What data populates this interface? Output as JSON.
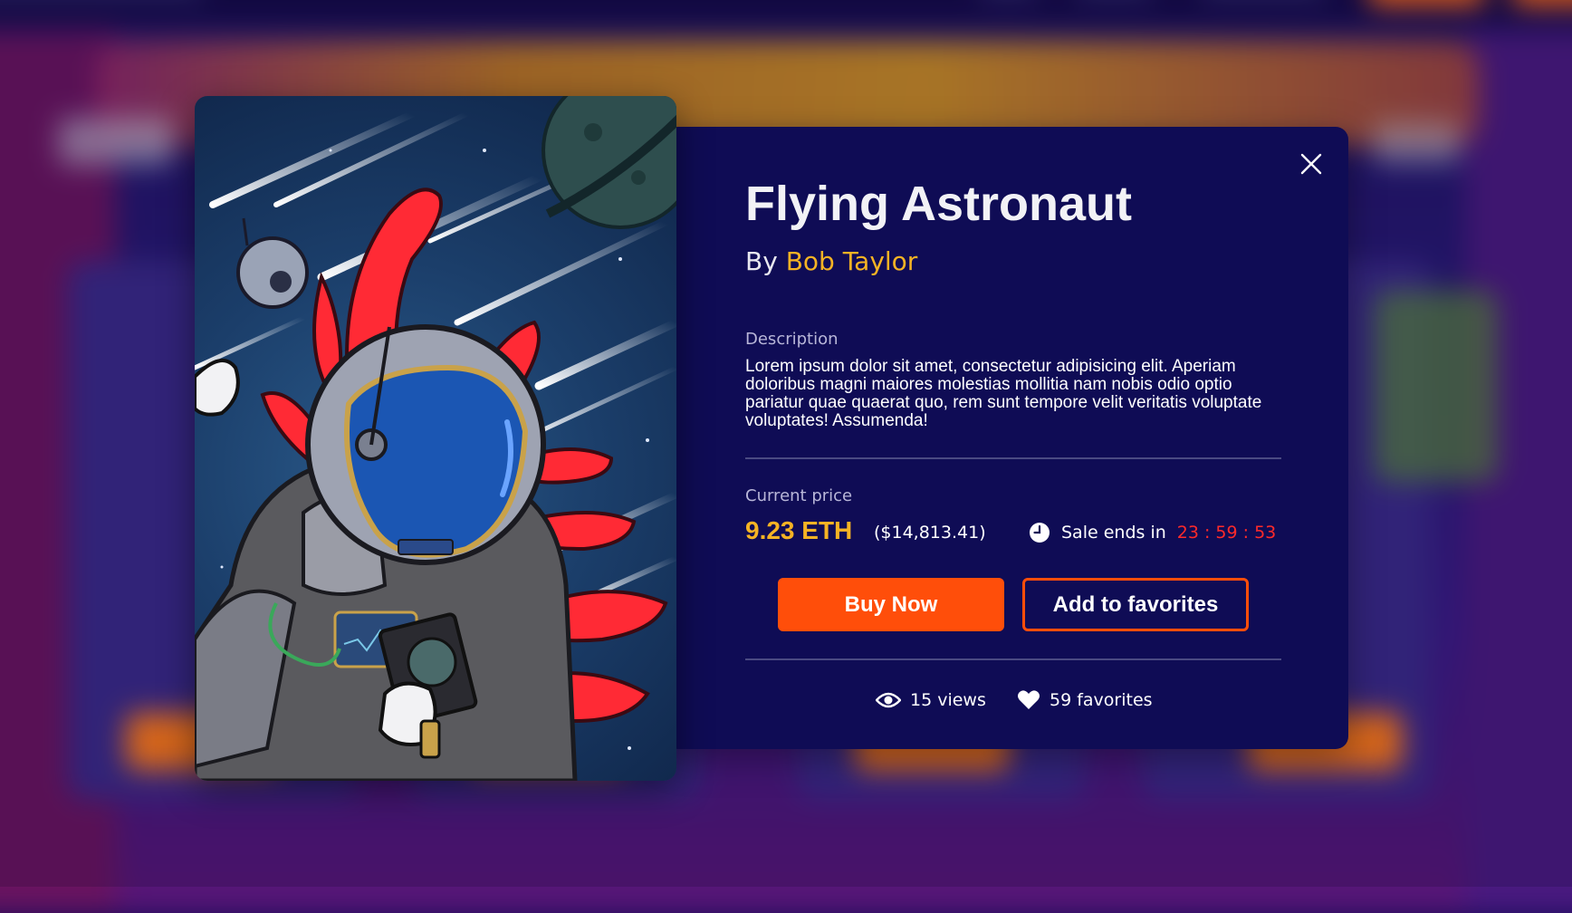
{
  "nft": {
    "title": "Flying Astronaut",
    "by_prefix": "By",
    "author": "Bob Taylor",
    "description_label": "Description",
    "description": "Lorem ipsum dolor sit amet, consectetur adipisicing elit. Aperiam doloribus magni maiores molestias mollitia nam nobis odio optio pariatur quae quaerat quo, rem sunt tempore velit veritatis voluptate voluptates! Assumenda!",
    "price_label": "Current price",
    "price_eth": "9.23 ETH",
    "price_usd": "($14,813.41)",
    "sale_label": "Sale ends in",
    "countdown": "23 : 59 : 53"
  },
  "actions": {
    "buy_label": "Buy Now",
    "favorite_label": "Add to favorites"
  },
  "stats": {
    "views": "15 views",
    "favorites": "59 favorites"
  },
  "icons": {
    "close": "close-icon",
    "clock": "clock-icon",
    "views": "eye-icon",
    "favorites": "heart-icon"
  },
  "colors": {
    "accent": "#ff4e0a",
    "author": "#f5b324",
    "price": "#f5b324",
    "countdown": "#ff2a2a",
    "modal_bg": "#0f0c55"
  }
}
